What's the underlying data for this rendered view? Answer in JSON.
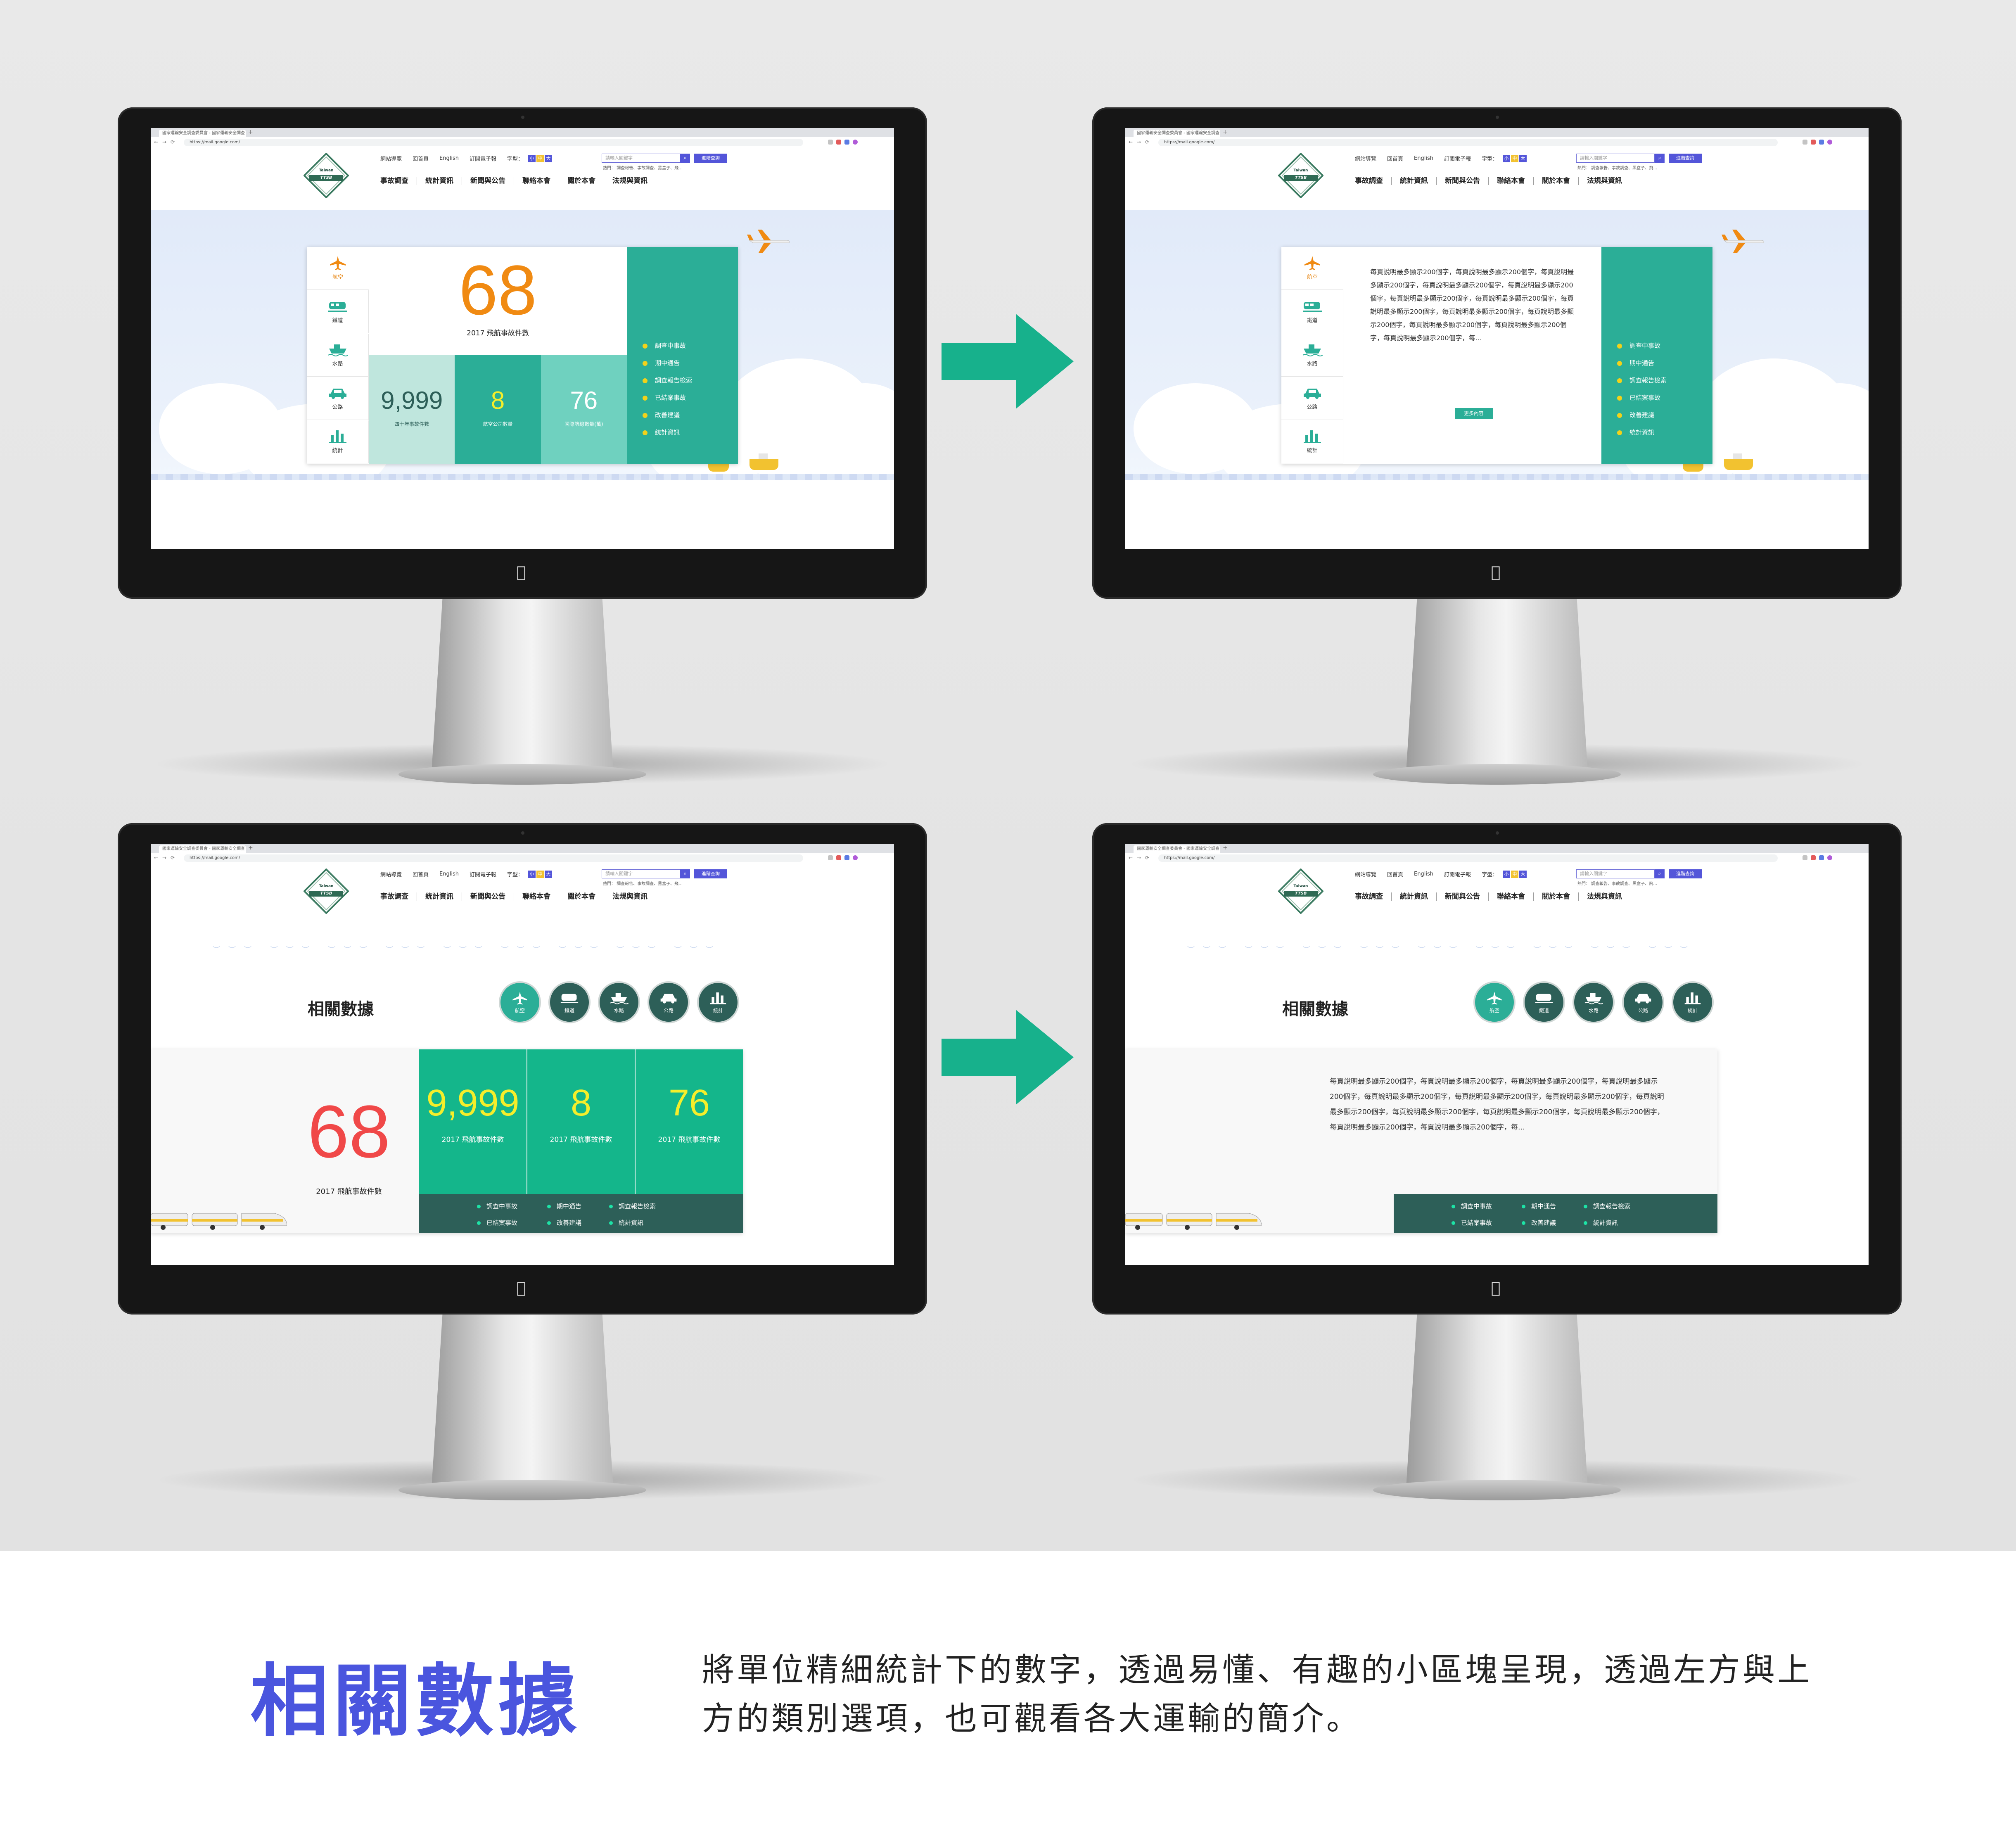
{
  "browser": {
    "tab_title": "國家運輸安全調查委員會 - 國家運輸安全調查委員會",
    "url": "https://mail.google.com/"
  },
  "site": {
    "logo_top": "Taiwan",
    "logo_band": "TTSB",
    "top_links": [
      "網站導覽",
      "回首頁",
      "English",
      "訂閱電子報"
    ],
    "font_size_label": "字型：",
    "font_sizes": [
      "小",
      "中",
      "大"
    ],
    "search_placeholder": "請輸入關鍵字",
    "advanced_search": "進階查詢",
    "hot_keywords": "熱門： 調查報告、事故調查、黑盒子、飛…",
    "main_nav": [
      "事故調查",
      "統計資訊",
      "新聞與公告",
      "聯絡本會",
      "關於本會",
      "法規與資訊"
    ]
  },
  "hero_card": {
    "categories": [
      "航空",
      "鐵道",
      "水路",
      "公路",
      "統計"
    ],
    "big_number": "68",
    "big_caption": "2017 飛航事故件數",
    "stats": [
      {
        "value": "9,999",
        "caption": "四十年事故件數"
      },
      {
        "value": "8",
        "caption": "航空公司數量"
      },
      {
        "value": "76",
        "caption": "國際航線數量(萬)"
      }
    ],
    "quick_links": [
      "調查中事故",
      "期中通告",
      "調查報告檢索",
      "已結案事故",
      "改善建議",
      "統計資訊"
    ],
    "description": "每頁說明最多顯示200個字，每頁說明最多顯示200個字，每頁說明最多顯示200個字，每頁說明最多顯示200個字，每頁說明最多顯示200個字，每頁說明最多顯示200個字，每頁說明最多顯示200個字，每頁說明最多顯示200個字，每頁說明最多顯示200個字，每頁說明最多顯示200個字，每頁說明最多顯示200個字，每頁說明最多顯示200個字，每頁說明最多顯示200個字，每…",
    "more_button": "更多內容"
  },
  "related": {
    "title": "相關數據",
    "categories": [
      "航空",
      "鐵道",
      "水路",
      "公路",
      "統計"
    ],
    "big_number": "68",
    "big_caption": "2017 飛航事故件數",
    "stats": [
      {
        "value": "9,999",
        "caption": "2017 飛航事故件數"
      },
      {
        "value": "8",
        "caption": "2017 飛航事故件數"
      },
      {
        "value": "76",
        "caption": "2017 飛航事故件數"
      }
    ],
    "links": [
      "調查中事故",
      "期中通告",
      "調查報告檢索",
      "已結案事故",
      "改善建議",
      "統計資訊"
    ],
    "description": "每頁說明最多顯示200個字，每頁說明最多顯示200個字，每頁說明最多顯示200個字，每頁說明最多顯示200個字，每頁說明最多顯示200個字，每頁說明最多顯示200個字，每頁說明最多顯示200個字，每頁說明最多顯示200個字，每頁說明最多顯示200個字，每頁說明最多顯示200個字，每頁說明最多顯示200個字，每頁說明最多顯示200個字，每頁說明最多顯示200個字，每…"
  },
  "footer": {
    "title": "相關數據",
    "description": "將單位精細統計下的數字，透過易懂、有趣的小區塊呈現，透過左方與上方的類別選項，也可觀看各大運輸的簡介。"
  },
  "colors": {
    "accent_teal": "#2bae97",
    "accent_green": "#14b68b",
    "dark_green": "#2d5f58",
    "orange": "#f08a12",
    "red": "#f04848",
    "purple": "#4a55de",
    "arrow": "#17b18c"
  },
  "icons": [
    "plane-icon",
    "train-icon",
    "ship-icon",
    "car-icon",
    "bar-chart-icon",
    "apple-logo-icon",
    "arrow-right-icon"
  ]
}
